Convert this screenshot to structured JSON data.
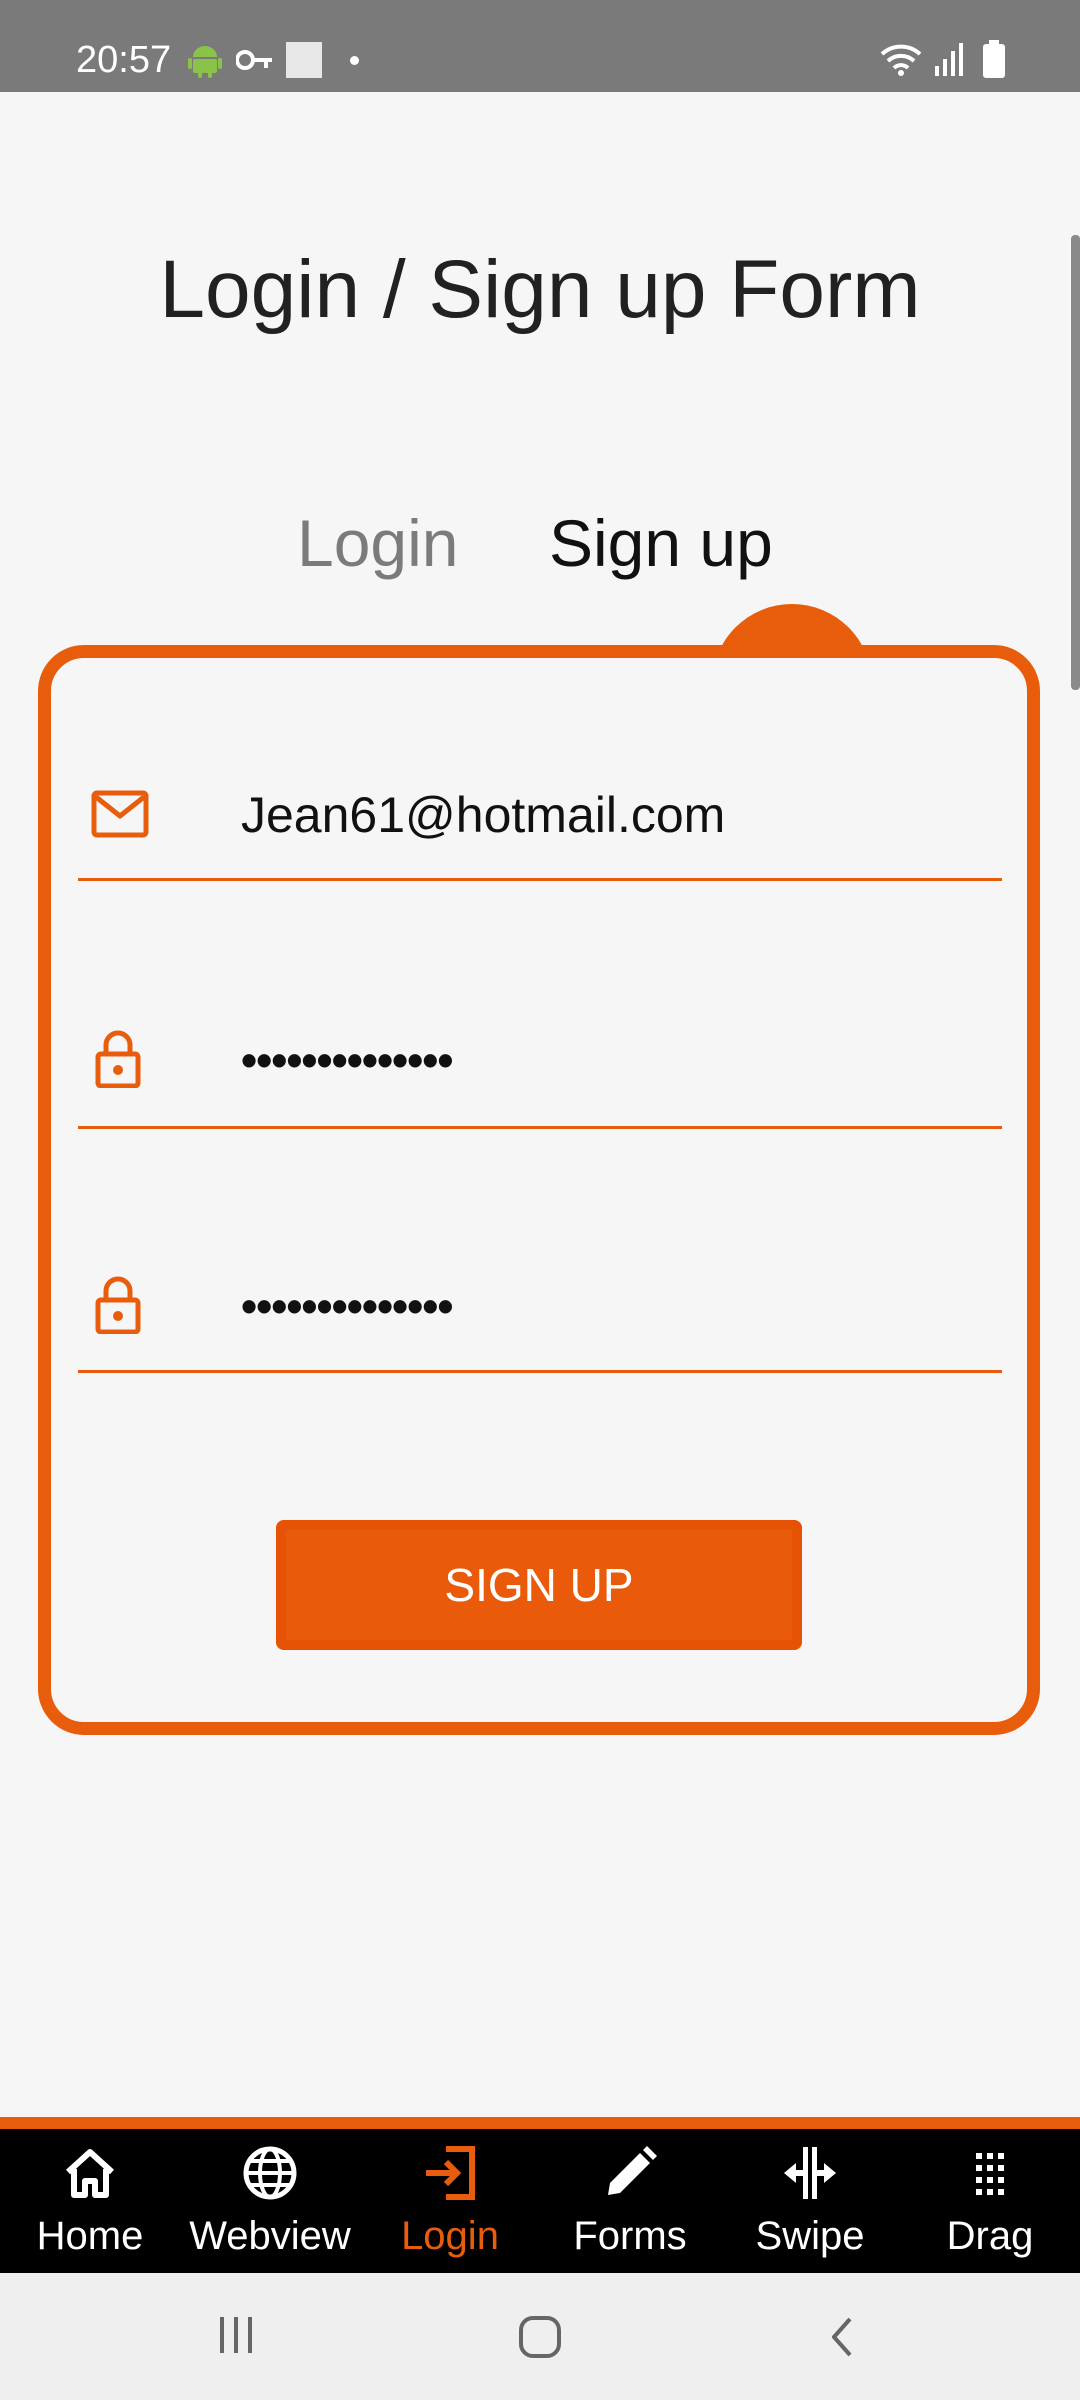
{
  "status_bar": {
    "time": "20:57",
    "left_icons": [
      "android-icon",
      "key-icon",
      "square-icon",
      "dot-icon"
    ],
    "right_icons": [
      "wifi-icon",
      "signal-icon",
      "battery-icon"
    ]
  },
  "page": {
    "title": "Login / Sign up Form"
  },
  "tabs": [
    {
      "label": "Login",
      "active": false
    },
    {
      "label": "Sign up",
      "active": true
    }
  ],
  "form": {
    "email": {
      "icon": "mail-icon",
      "value": "Jean61@hotmail.com"
    },
    "password": {
      "icon": "lock-icon",
      "value": "••••••••••••••"
    },
    "repeat_password": {
      "icon": "lock-icon",
      "value": "••••••••••••••"
    },
    "submit_label": "SIGN UP"
  },
  "bottom_nav": {
    "items": [
      {
        "label": "Home",
        "icon": "home-icon",
        "active": false
      },
      {
        "label": "Webview",
        "icon": "globe-icon",
        "active": false
      },
      {
        "label": "Login",
        "icon": "login-icon",
        "active": true
      },
      {
        "label": "Forms",
        "icon": "pencil-icon",
        "active": false
      },
      {
        "label": "Swipe",
        "icon": "swipe-icon",
        "active": false
      },
      {
        "label": "Drag",
        "icon": "grid-icon",
        "active": false
      }
    ]
  },
  "system_nav": {
    "buttons": [
      "recents-icon",
      "home-circle-icon",
      "back-icon"
    ]
  },
  "colors": {
    "accent": "#e85d0c",
    "background": "#f6f6f6",
    "status_bar": "#7a7a7a",
    "nav_background": "#000000"
  }
}
